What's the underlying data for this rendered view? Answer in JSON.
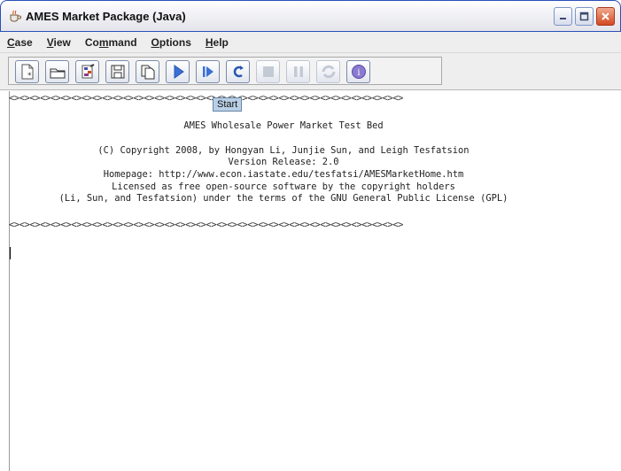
{
  "window": {
    "title": "AMES Market Package (Java)"
  },
  "menu": [
    {
      "pre": "",
      "u": "C",
      "post": "ase"
    },
    {
      "pre": "",
      "u": "V",
      "post": "iew"
    },
    {
      "pre": "Co",
      "u": "m",
      "post": "mand"
    },
    {
      "pre": "",
      "u": "O",
      "post": "ptions"
    },
    {
      "pre": "",
      "u": "H",
      "post": "elp"
    }
  ],
  "toolbar": {
    "buttons": [
      {
        "icon": "new-case-icon",
        "enabled": true
      },
      {
        "icon": "open-folder-icon",
        "enabled": true
      },
      {
        "icon": "edit-case-icon",
        "enabled": true
      },
      {
        "icon": "save-disk-icon",
        "enabled": true
      },
      {
        "icon": "save-as-icon",
        "enabled": true
      },
      {
        "icon": "start-icon",
        "enabled": true
      },
      {
        "icon": "step-icon",
        "enabled": true
      },
      {
        "icon": "reset-icon",
        "enabled": true
      },
      {
        "icon": "stop-icon",
        "enabled": false
      },
      {
        "icon": "pause-icon",
        "enabled": false
      },
      {
        "icon": "refresh-icon",
        "enabled": false
      },
      {
        "icon": "info-icon",
        "enabled": true
      }
    ],
    "tooltip": "Start"
  },
  "output": {
    "separator": "<><><><><><><><><><><><><><><><><><><><><><><><><><><><><><><><><><><><><><>",
    "lines": [
      "AMES Wholesale Power Market Test Bed",
      "(C) Copyright 2008, by Hongyan Li, Junjie Sun, and Leigh Tesfatsion",
      "Version Release: 2.0",
      "Homepage: http://www.econ.iastate.edu/tesfatsi/AMESMarketHome.htm",
      "Licensed as free open-source software by the copyright holders",
      "(Li, Sun, and Tesfatsion) under the terms of the GNU General Public License (GPL)"
    ]
  }
}
